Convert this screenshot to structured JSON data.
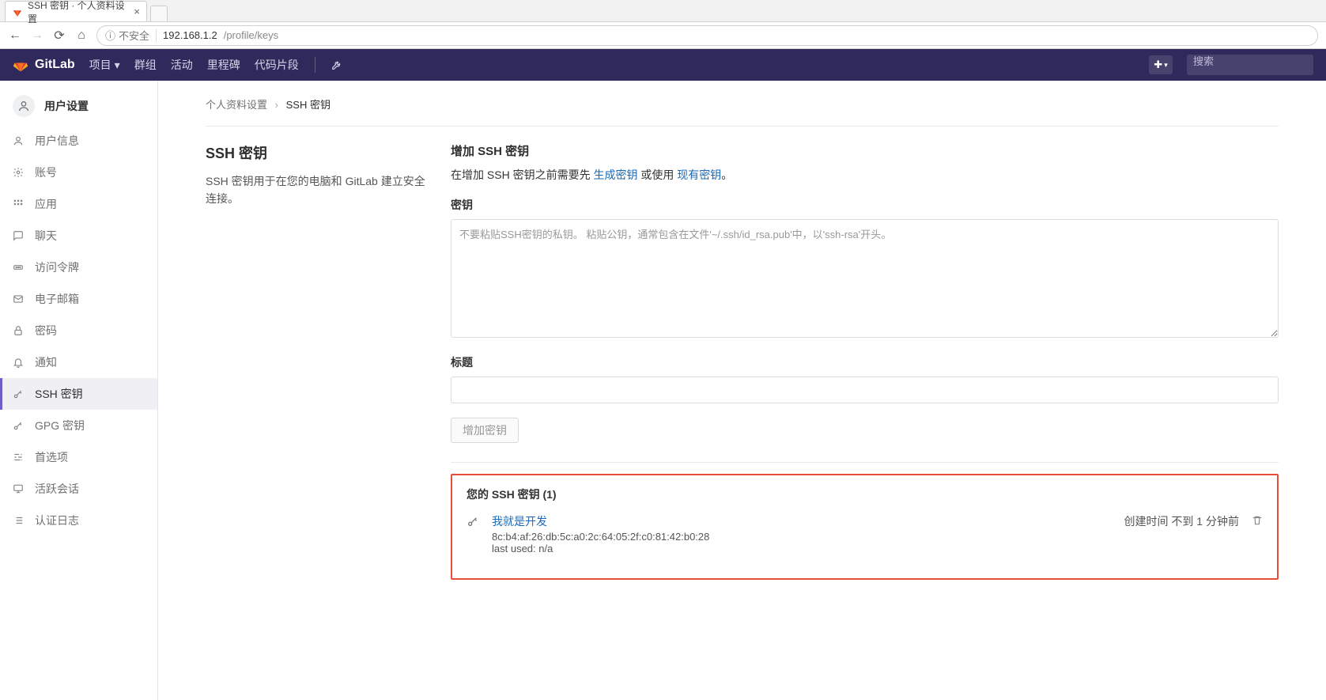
{
  "browser": {
    "tab_title": "SSH 密钥 · 个人资料设置",
    "security_label": "不安全",
    "url_host": "192.168.1.2",
    "url_path": "/profile/keys"
  },
  "topnav": {
    "brand": "GitLab",
    "items": [
      "项目",
      "群组",
      "活动",
      "里程碑",
      "代码片段"
    ],
    "search_placeholder": "搜索"
  },
  "sidebar": {
    "header": "用户设置",
    "items": [
      {
        "label": "用户信息",
        "icon": "user-icon"
      },
      {
        "label": "账号",
        "icon": "gear-icon"
      },
      {
        "label": "应用",
        "icon": "grid-icon"
      },
      {
        "label": "聊天",
        "icon": "chat-icon"
      },
      {
        "label": "访问令牌",
        "icon": "token-icon"
      },
      {
        "label": "电子邮箱",
        "icon": "mail-icon"
      },
      {
        "label": "密码",
        "icon": "lock-icon"
      },
      {
        "label": "通知",
        "icon": "bell-icon"
      },
      {
        "label": "SSH 密钥",
        "icon": "key-icon",
        "active": true
      },
      {
        "label": "GPG 密钥",
        "icon": "key-icon"
      },
      {
        "label": "首选项",
        "icon": "sliders-icon"
      },
      {
        "label": "活跃会话",
        "icon": "monitor-icon"
      },
      {
        "label": "认证日志",
        "icon": "list-icon"
      }
    ]
  },
  "breadcrumb": {
    "root": "个人资料设置",
    "current": "SSH 密钥"
  },
  "left": {
    "title": "SSH 密钥",
    "desc": "SSH 密钥用于在您的电脑和 GitLab 建立安全连接。"
  },
  "form": {
    "title": "增加 SSH 密钥",
    "help_pre": "在增加 SSH 密钥之前需要先 ",
    "help_link1": "生成密钥",
    "help_mid": " 或使用 ",
    "help_link2": "现有密钥",
    "help_post": "。",
    "key_label": "密钥",
    "key_placeholder": "不要粘贴SSH密钥的私钥。 粘贴公钥，通常包含在文件'~/.ssh/id_rsa.pub'中，以'ssh-rsa'开头。",
    "title_label": "标题",
    "submit": "增加密钥"
  },
  "keys": {
    "heading": "您的 SSH 密钥 (1)",
    "list": [
      {
        "name": "我就是开发",
        "fingerprint": "8c:b4:af:26:db:5c:a0:2c:64:05:2f:c0:81:42:b0:28",
        "last_used": "last used: n/a",
        "created": "创建时间 不到 1 分钟前"
      }
    ]
  }
}
